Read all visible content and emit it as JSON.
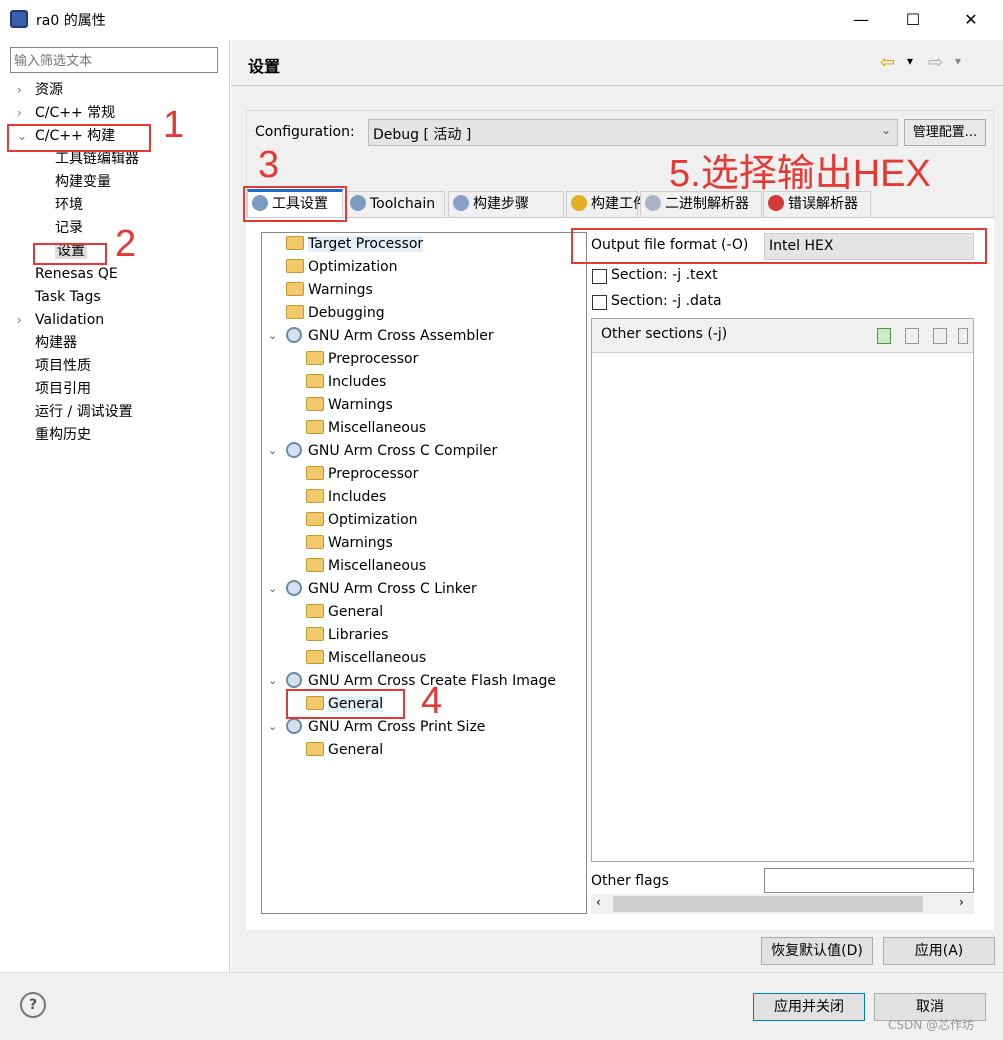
{
  "window": {
    "title": "ra0 的属性",
    "minimize": "—",
    "maximize": "☐",
    "close": "✕"
  },
  "left": {
    "filter_placeholder": "输入筛选文本",
    "items": [
      {
        "label": "资源",
        "level": 0,
        "arrow": "›"
      },
      {
        "label": "C/C++ 常规",
        "level": 0,
        "arrow": "›"
      },
      {
        "label": "C/C++ 构建",
        "level": 0,
        "arrow": "⌄"
      },
      {
        "label": "工具链编辑器",
        "level": 1
      },
      {
        "label": "构建变量",
        "level": 1
      },
      {
        "label": "环境",
        "level": 1
      },
      {
        "label": "记录",
        "level": 1
      },
      {
        "label": "设置",
        "level": 1,
        "selected": true
      },
      {
        "label": "Renesas QE",
        "level": 0
      },
      {
        "label": "Task Tags",
        "level": 0
      },
      {
        "label": "Validation",
        "level": 0,
        "arrow": "›"
      },
      {
        "label": "构建器",
        "level": 0
      },
      {
        "label": "项目性质",
        "level": 0
      },
      {
        "label": "项目引用",
        "level": 0
      },
      {
        "label": "运行 / 调试设置",
        "level": 0
      },
      {
        "label": "重构历史",
        "level": 0
      }
    ]
  },
  "header": {
    "title": "设置",
    "back": "⇦",
    "forward": "⇨",
    "dropdown": "▾"
  },
  "config": {
    "label": "Configuration:",
    "value": "Debug  [ 活动 ]",
    "manage": "管理配置..."
  },
  "tabs": [
    {
      "label": "工具设置",
      "active": true,
      "icon": "gear-icon",
      "color": "#7a9cc0"
    },
    {
      "label": "Toolchain",
      "icon": "gear-icon",
      "color": "#7a9cc0"
    },
    {
      "label": "构建步骤",
      "icon": "build-steps-icon",
      "color": "#8aa0c8"
    },
    {
      "label": "构建工件",
      "icon": "trophy-icon",
      "color": "#e0b020"
    },
    {
      "label": "二进制解析器",
      "icon": "binary-file-icon",
      "color": "#aab4c4"
    },
    {
      "label": "错误解析器",
      "icon": "error-icon",
      "color": "#d43a3a"
    }
  ],
  "tree": [
    {
      "label": "Target Processor",
      "level": 0,
      "icon": "folder",
      "selected": true
    },
    {
      "label": "Optimization",
      "level": 0,
      "icon": "folder"
    },
    {
      "label": "Warnings",
      "level": 0,
      "icon": "folder"
    },
    {
      "label": "Debugging",
      "level": 0,
      "icon": "folder"
    },
    {
      "label": "GNU Arm Cross Assembler",
      "level": 0,
      "icon": "gear",
      "expanded": true
    },
    {
      "label": "Preprocessor",
      "level": 1,
      "icon": "folder"
    },
    {
      "label": "Includes",
      "level": 1,
      "icon": "folder"
    },
    {
      "label": "Warnings",
      "level": 1,
      "icon": "folder"
    },
    {
      "label": "Miscellaneous",
      "level": 1,
      "icon": "folder"
    },
    {
      "label": "GNU Arm Cross C Compiler",
      "level": 0,
      "icon": "gear",
      "expanded": true
    },
    {
      "label": "Preprocessor",
      "level": 1,
      "icon": "folder"
    },
    {
      "label": "Includes",
      "level": 1,
      "icon": "folder"
    },
    {
      "label": "Optimization",
      "level": 1,
      "icon": "folder"
    },
    {
      "label": "Warnings",
      "level": 1,
      "icon": "folder"
    },
    {
      "label": "Miscellaneous",
      "level": 1,
      "icon": "folder"
    },
    {
      "label": "GNU Arm Cross C Linker",
      "level": 0,
      "icon": "gear",
      "expanded": true
    },
    {
      "label": "General",
      "level": 1,
      "icon": "folder"
    },
    {
      "label": "Libraries",
      "level": 1,
      "icon": "folder"
    },
    {
      "label": "Miscellaneous",
      "level": 1,
      "icon": "folder"
    },
    {
      "label": "GNU Arm Cross Create Flash Image",
      "level": 0,
      "icon": "gear",
      "expanded": true
    },
    {
      "label": "General",
      "level": 1,
      "icon": "folder",
      "selected": true
    },
    {
      "label": "GNU Arm Cross Print Size",
      "level": 0,
      "icon": "gear",
      "expanded": true
    },
    {
      "label": "General",
      "level": 1,
      "icon": "folder"
    }
  ],
  "settings": {
    "output_format_label": "Output file format (-O)",
    "output_format_value": "Intel HEX",
    "section_text": "Section: -j .text",
    "section_text_checked": false,
    "section_data": "Section: -j .data",
    "section_data_checked": false,
    "other_sections": "Other sections (-j)",
    "other_flags": "Other flags",
    "other_flags_value": ""
  },
  "buttons": {
    "restore": "恢复默认值(D)",
    "apply": "应用(A)",
    "apply_close": "应用并关闭",
    "cancel": "取消",
    "help": "?"
  },
  "annotations": {
    "a1": "1",
    "a2": "2",
    "a3": "3",
    "a4": "4",
    "a5": "5.选择输出HEX"
  },
  "watermark": "CSDN @芯作坊"
}
